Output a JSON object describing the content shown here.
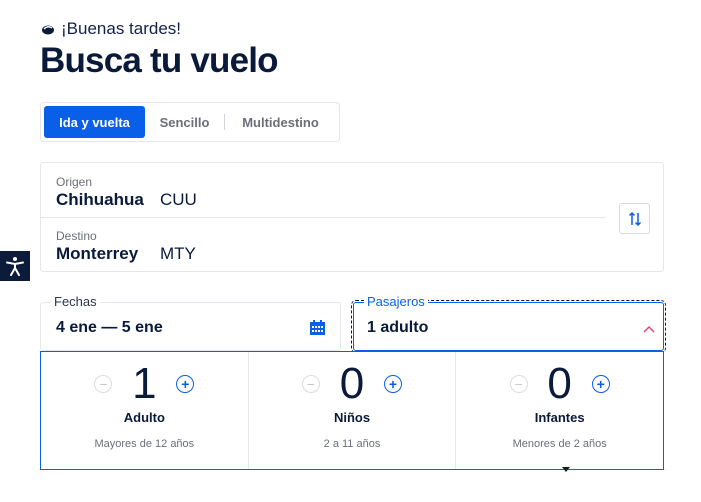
{
  "header": {
    "greeting": "¡Buenas tardes!",
    "title": "Busca tu vuelo"
  },
  "trip_type": {
    "tabs": [
      {
        "label": "Ida y vuelta",
        "active": true
      },
      {
        "label": "Sencillo",
        "active": false
      },
      {
        "label": "Multidestino",
        "active": false
      }
    ]
  },
  "route": {
    "origin_label": "Origen",
    "origin_city": "Chihuahua",
    "origin_code": "CUU",
    "destination_label": "Destino",
    "destination_city": "Monterrey",
    "destination_code": "MTY",
    "swap_icon": "swap-arrows-icon"
  },
  "dates": {
    "label": "Fechas",
    "value": "4 ene — 5 ene",
    "icon": "calendar-icon"
  },
  "passengers": {
    "label": "Pasajeros",
    "value": "1 adulto",
    "groups": [
      {
        "count": "1",
        "title": "Adulto",
        "subtitle": "Mayores de 12 años"
      },
      {
        "count": "0",
        "title": "Niños",
        "subtitle": "2 a 11 años"
      },
      {
        "count": "0",
        "title": "Infantes",
        "subtitle": "Menores de 2 años"
      }
    ]
  },
  "colors": {
    "accent": "#0a5fe8",
    "text": "#0a1a3a",
    "muted": "#6b6f7a",
    "border": "#e3e6ec",
    "chevron": "#e0486a"
  }
}
